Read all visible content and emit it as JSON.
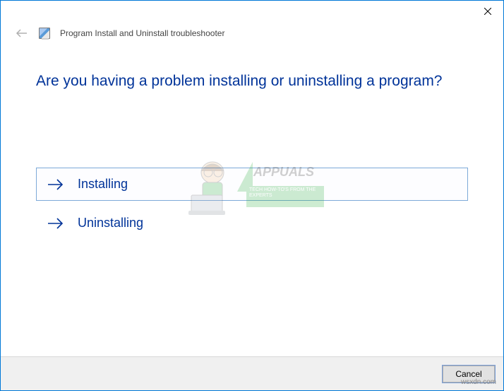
{
  "window": {
    "title": "Program Install and Uninstall troubleshooter"
  },
  "content": {
    "heading": "Are you having a problem installing or uninstalling a program?",
    "options": [
      {
        "label": "Installing",
        "selected": true
      },
      {
        "label": "Uninstalling",
        "selected": false
      }
    ]
  },
  "footer": {
    "cancel": "Cancel"
  },
  "watermark": {
    "brand": "APPUALS",
    "tagline": "TECH HOW-TO'S FROM THE EXPERTS"
  },
  "attribution": "wsxdn.com"
}
